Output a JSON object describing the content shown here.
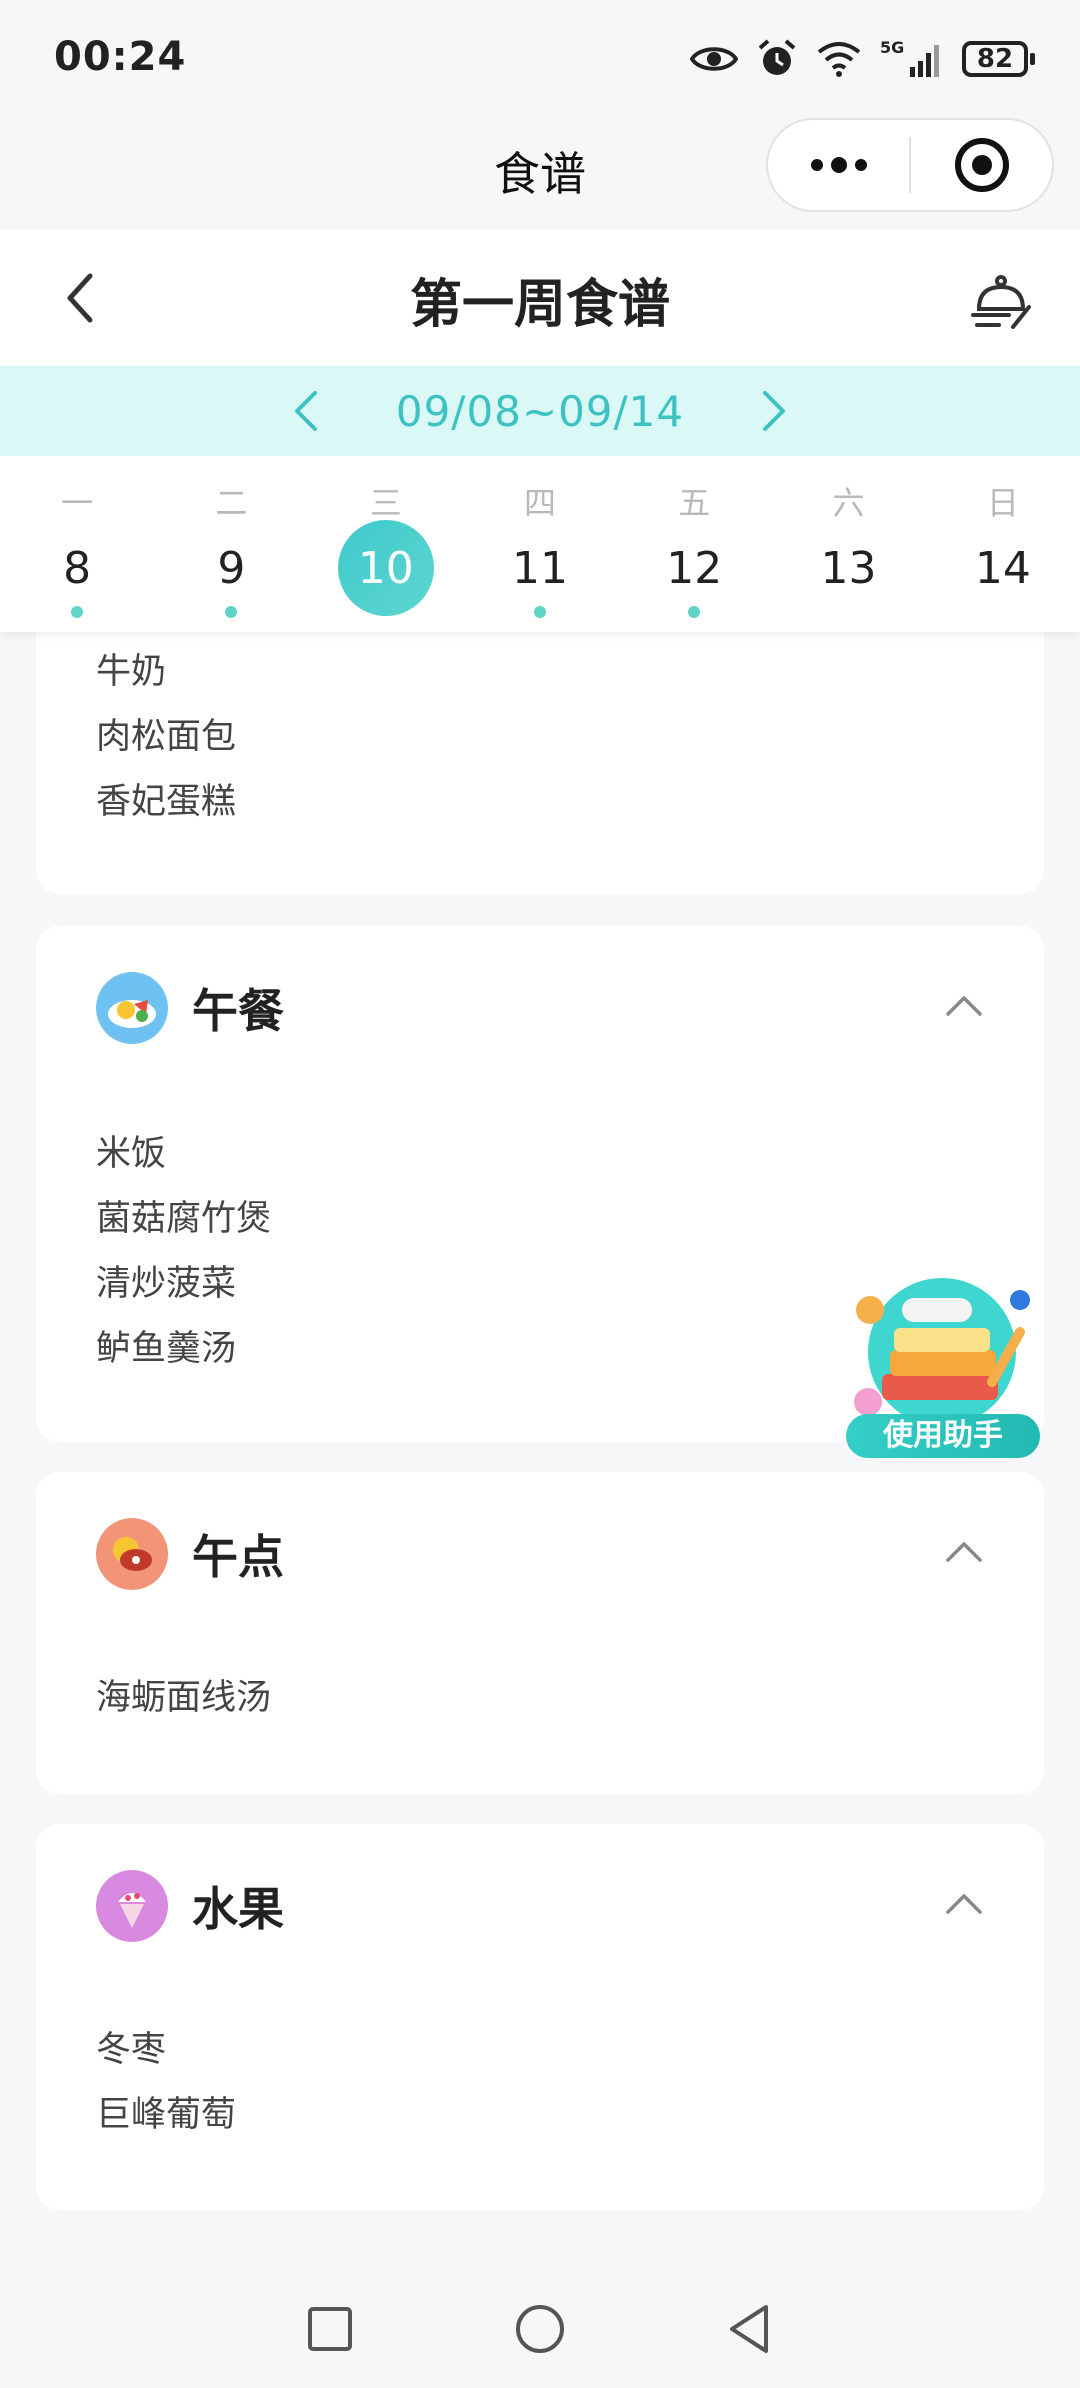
{
  "status_bar": {
    "time": "00:24",
    "battery": "82",
    "network": "5G"
  },
  "miniprogram": {
    "title": "食谱"
  },
  "header": {
    "title": "第一周食谱"
  },
  "week": {
    "range": "09/08~09/14"
  },
  "calendar": {
    "days": [
      {
        "weekday": "一",
        "date": "8",
        "has_menu": true
      },
      {
        "weekday": "二",
        "date": "9",
        "has_menu": true
      },
      {
        "weekday": "三",
        "date": "10",
        "has_menu": false,
        "selected": true
      },
      {
        "weekday": "四",
        "date": "11",
        "has_menu": true
      },
      {
        "weekday": "五",
        "date": "12",
        "has_menu": true
      },
      {
        "weekday": "六",
        "date": "13",
        "has_menu": false
      },
      {
        "weekday": "日",
        "date": "14",
        "has_menu": false
      }
    ]
  },
  "meals": {
    "breakfast": {
      "items": [
        "牛奶",
        "肉松面包",
        "香妃蛋糕"
      ]
    },
    "lunch": {
      "title": "午餐",
      "items": [
        "米饭",
        "菌菇腐竹煲",
        "清炒菠菜",
        "鲈鱼羹汤"
      ]
    },
    "snack": {
      "title": "午点",
      "items": [
        "海蛎面线汤"
      ]
    },
    "fruit": {
      "title": "水果",
      "items": [
        "冬枣",
        "巨峰葡萄"
      ]
    }
  },
  "helper": {
    "label": "使用助手"
  },
  "colors": {
    "accent": "#3cc3c1",
    "week_bar_bg": "#d9f8f6",
    "dot": "#5fd4c7"
  }
}
